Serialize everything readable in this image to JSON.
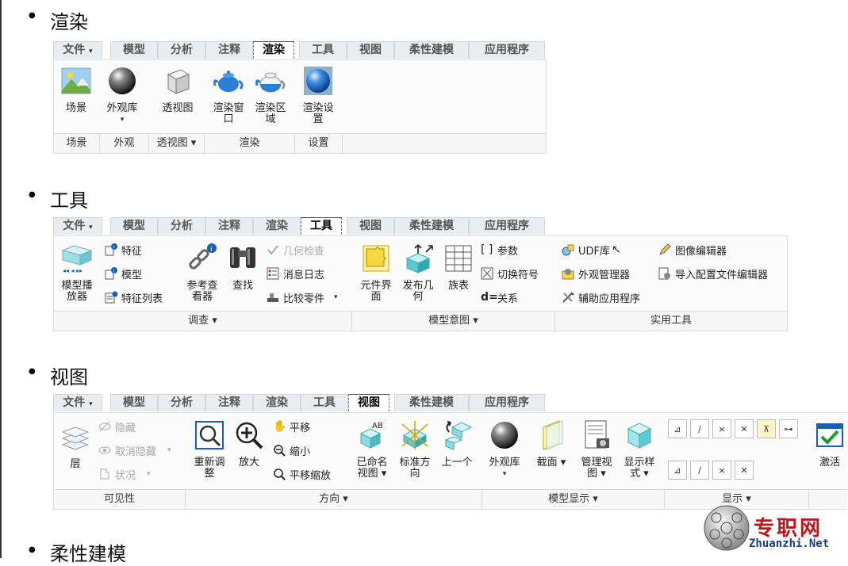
{
  "sections": [
    {
      "heading": "渲染",
      "tabs": [
        "文件",
        "模型",
        "分析",
        "注释",
        "渲染",
        "工具",
        "视图",
        "柔性建模",
        "应用程序"
      ],
      "file_arrow": "▾",
      "active_tab": "渲染",
      "buttons": [
        "场景",
        "外观库",
        "透视图",
        "渲染窗口",
        "渲染区域",
        "渲染设置"
      ],
      "button_lines": [
        [
          "场景"
        ],
        [
          "外观库"
        ],
        [
          "透视图"
        ],
        [
          "渲染窗",
          "口"
        ],
        [
          "渲染区",
          "域"
        ],
        [
          "渲染设",
          "置"
        ]
      ],
      "groups": [
        "场景",
        "外观",
        "透视图 ▾",
        "渲染",
        "设置"
      ]
    },
    {
      "heading": "工具",
      "tabs": [
        "文件",
        "模型",
        "分析",
        "注释",
        "渲染",
        "工具",
        "视图",
        "柔性建模",
        "应用程序"
      ],
      "active_tab": "工具",
      "big_buttons": {
        "model_player": [
          "模型播",
          "放器"
        ],
        "ref_viewer": [
          "参考查",
          "看器"
        ],
        "find": [
          "查找"
        ],
        "component_interface": [
          "元件界",
          "面"
        ],
        "publish_geometry": [
          "发布几",
          "何"
        ],
        "family_table": [
          "族表"
        ]
      },
      "small_items": {
        "feature": "特征",
        "model": "模型",
        "feature_list": "特征列表",
        "geometry_check": "几何检查",
        "message_log": "消息日志",
        "compare_parts": "比较零件",
        "parameters": "参数",
        "switch_symbols": "切换符号",
        "relations": "关系",
        "udf_library": "UDF库",
        "appearance_manager": "外观管理器",
        "aux_apps": "辅助应用程序",
        "image_editor": "图像编辑器",
        "config_editor": "导入配置文件编辑器"
      },
      "groups": [
        "调查 ▾",
        "模型意图 ▾",
        "实用工具"
      ]
    },
    {
      "heading": "视图",
      "tabs": [
        "文件",
        "模型",
        "分析",
        "注释",
        "渲染",
        "工具",
        "视图",
        "柔性建模",
        "应用程序"
      ],
      "active_tab": "视图",
      "small_items": {
        "hide": "隐藏",
        "unhide": "取消隐藏",
        "status": "状况",
        "pan": "平移",
        "zoom_out": "缩小",
        "pan_zoom": "平移缩放"
      },
      "big_buttons": {
        "layers": [
          "层"
        ],
        "refit": [
          "重新调",
          "整"
        ],
        "zoom_in": [
          "放大"
        ],
        "named_views": [
          "已命名",
          "视图 ▾"
        ],
        "standard_orientation": [
          "标准方",
          "向"
        ],
        "previous": [
          "上一个"
        ],
        "appearance_gallery": [
          "外观库",
          "▾"
        ],
        "section": [
          "截面 ▾"
        ],
        "manage_views": [
          "管理视",
          "图 ▾"
        ],
        "display_style": [
          "显示样",
          "式 ▾"
        ],
        "activate": [
          "激活"
        ]
      },
      "groups": [
        "可见性",
        "方向 ▾",
        "模型显示 ▾",
        "显示 ▾"
      ]
    },
    {
      "heading": "柔性建模"
    }
  ],
  "watermark": {
    "title": "专职网",
    "url": "Zhuanzhi.Net",
    "title_color": "#c0161b",
    "url_color": "#1a3c8a"
  },
  "icons": [
    "landscape-icon",
    "sphere-icon",
    "cube-icon",
    "teapot-icon",
    "binoculars-icon",
    "chain-icon",
    "puzzle-icon",
    "table-icon",
    "magnifier-icon",
    "checkmark-icon"
  ]
}
